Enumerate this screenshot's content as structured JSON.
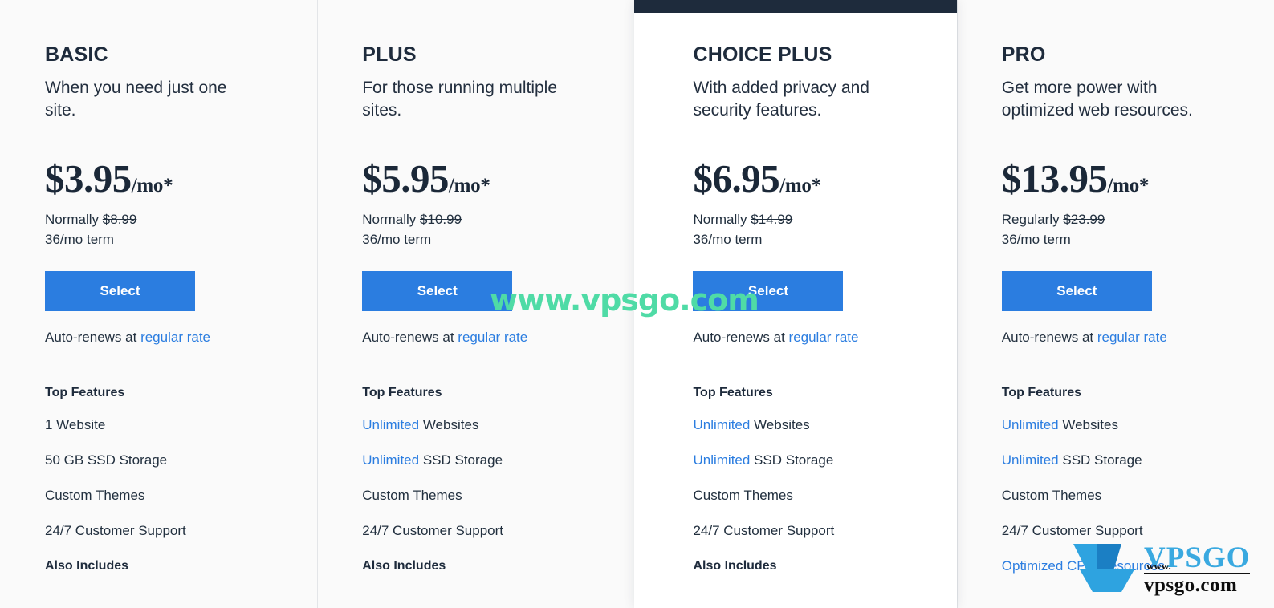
{
  "theme": {
    "accent_blue": "#2b7de0",
    "dark_navy": "#1e2b3c",
    "page_bg": "#fafafa",
    "featured_bg": "#ffffff",
    "watermark_green": "#4fdba6",
    "watermark_logo_blue": "#3aa9e0"
  },
  "plans": [
    {
      "name": "BASIC",
      "tagline": "When you need just one site.",
      "price": "$3.95",
      "price_period": "/mo*",
      "normally_label": "Normally",
      "normally_price": "$8.99",
      "term": "36/mo term",
      "select_label": "Select",
      "renew_prefix": "Auto-renews at ",
      "renew_link": "regular rate",
      "features_title": "Top Features",
      "features": [
        {
          "highlight": "",
          "text": "1 Website"
        },
        {
          "highlight": "",
          "text": "50 GB SSD Storage"
        },
        {
          "highlight": "",
          "text": "Custom Themes"
        },
        {
          "highlight": "",
          "text": "24/7 Customer Support"
        }
      ],
      "also_includes": "Also Includes",
      "featured": false
    },
    {
      "name": "PLUS",
      "tagline": "For those running multiple sites.",
      "price": "$5.95",
      "price_period": "/mo*",
      "normally_label": "Normally",
      "normally_price": "$10.99",
      "term": "36/mo term",
      "select_label": "Select",
      "renew_prefix": "Auto-renews at ",
      "renew_link": "regular rate",
      "features_title": "Top Features",
      "features": [
        {
          "highlight": "Unlimited",
          "text": " Websites"
        },
        {
          "highlight": "Unlimited",
          "text": " SSD Storage"
        },
        {
          "highlight": "",
          "text": "Custom Themes"
        },
        {
          "highlight": "",
          "text": "24/7 Customer Support"
        }
      ],
      "also_includes": "Also Includes",
      "featured": false
    },
    {
      "name": "CHOICE PLUS",
      "tagline": "With added privacy and security features.",
      "price": "$6.95",
      "price_period": "/mo*",
      "normally_label": "Normally",
      "normally_price": "$14.99",
      "term": "36/mo term",
      "select_label": "Select",
      "renew_prefix": "Auto-renews at ",
      "renew_link": "regular rate",
      "features_title": "Top Features",
      "features": [
        {
          "highlight": "Unlimited",
          "text": " Websites"
        },
        {
          "highlight": "Unlimited",
          "text": " SSD Storage"
        },
        {
          "highlight": "",
          "text": "Custom Themes"
        },
        {
          "highlight": "",
          "text": "24/7 Customer Support"
        }
      ],
      "also_includes": "Also Includes",
      "featured": true
    },
    {
      "name": "PRO",
      "tagline": "Get more power with optimized web resources.",
      "price": "$13.95",
      "price_period": "/mo*",
      "normally_label": "Regularly",
      "normally_price": "$23.99",
      "term": "36/mo term",
      "select_label": "Select",
      "renew_prefix": "Auto-renews at ",
      "renew_link": "regular rate",
      "features_title": "Top Features",
      "features": [
        {
          "highlight": "Unlimited",
          "text": " Websites"
        },
        {
          "highlight": "Unlimited",
          "text": " SSD Storage"
        },
        {
          "highlight": "",
          "text": "Custom Themes"
        },
        {
          "highlight": "",
          "text": "24/7 Customer Support"
        },
        {
          "highlight": "Optimized CPU Resources",
          "text": ""
        }
      ],
      "also_includes": "",
      "featured": false
    }
  ],
  "watermarks": {
    "banner_text": "www.vpsgo.com",
    "logo_brand": "VPSGO",
    "logo_site": "vpsgo.com",
    "logo_tiny": "www."
  }
}
